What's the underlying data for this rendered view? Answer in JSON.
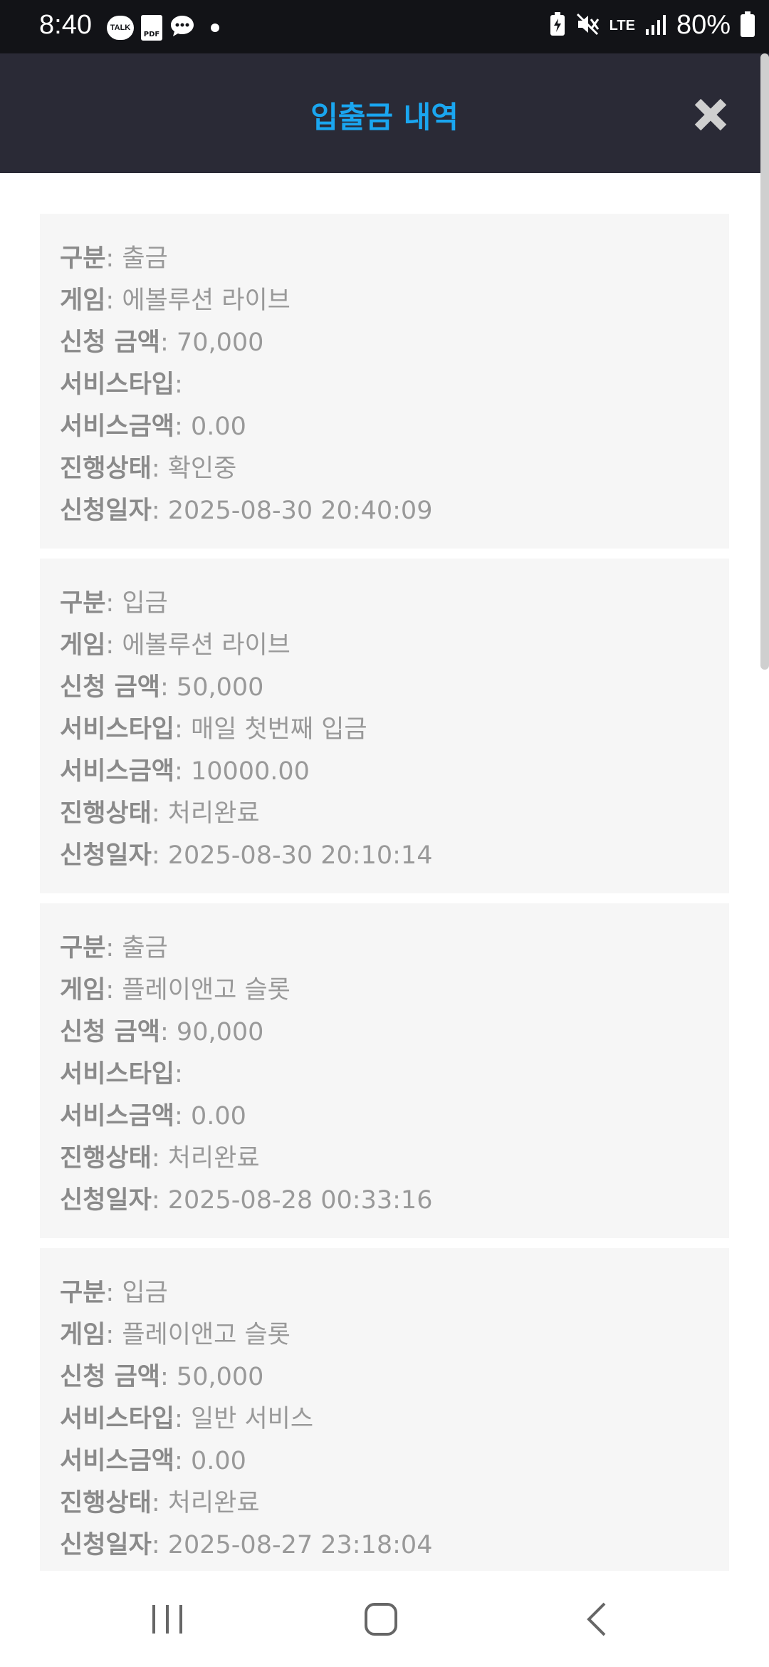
{
  "status_bar": {
    "time": "8:40",
    "notif_talk": "TALK",
    "notif_pdf": "PDF",
    "network": "LTE",
    "battery": "80%"
  },
  "header": {
    "title": "입출금 내역"
  },
  "labels": {
    "type": "구분",
    "game": "게임",
    "amount": "신청 금액",
    "service_type": "서비스타입",
    "service_amount": "서비스금액",
    "status": "진행상태",
    "date": "신청일자"
  },
  "records": [
    {
      "type": "출금",
      "game": "에볼루션 라이브",
      "amount": "70,000",
      "service_type": "",
      "service_amount": "0.00",
      "status": "확인중",
      "date": "2025-08-30 20:40:09"
    },
    {
      "type": "입금",
      "game": "에볼루션 라이브",
      "amount": "50,000",
      "service_type": "매일 첫번째 입금",
      "service_amount": "10000.00",
      "status": "처리완료",
      "date": "2025-08-30 20:10:14"
    },
    {
      "type": "출금",
      "game": "플레이앤고 슬롯",
      "amount": "90,000",
      "service_type": "",
      "service_amount": "0.00",
      "status": "처리완료",
      "date": "2025-08-28 00:33:16"
    },
    {
      "type": "입금",
      "game": "플레이앤고 슬롯",
      "amount": "50,000",
      "service_type": "일반 서비스",
      "service_amount": "0.00",
      "status": "처리완료",
      "date": "2025-08-27 23:18:04"
    }
  ]
}
